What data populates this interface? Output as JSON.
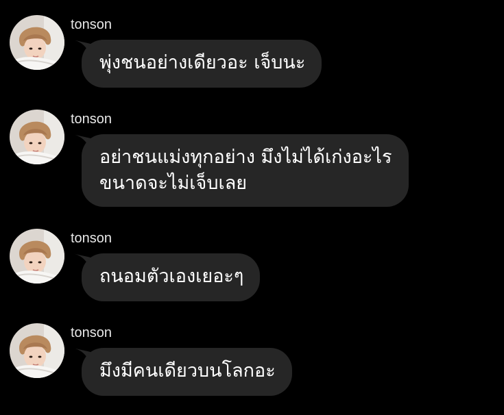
{
  "messages": [
    {
      "sender": "tonson",
      "text": "พุ่งชนอย่างเดียวอะ เจ็บนะ"
    },
    {
      "sender": "tonson",
      "text": "อย่าชนแม่งทุกอย่าง มึงไม่ได้เก่งอะไร\nขนาดจะไม่เจ็บเลย"
    },
    {
      "sender": "tonson",
      "text": "ถนอมตัวเองเยอะๆ"
    },
    {
      "sender": "tonson",
      "text": "มึงมีคนเดียวบนโลกอะ"
    }
  ],
  "colors": {
    "background": "#000000",
    "bubble": "#262626",
    "text": "#ffffff",
    "sender": "#e9e9e9"
  },
  "icons": {
    "avatar": "profile-photo"
  }
}
